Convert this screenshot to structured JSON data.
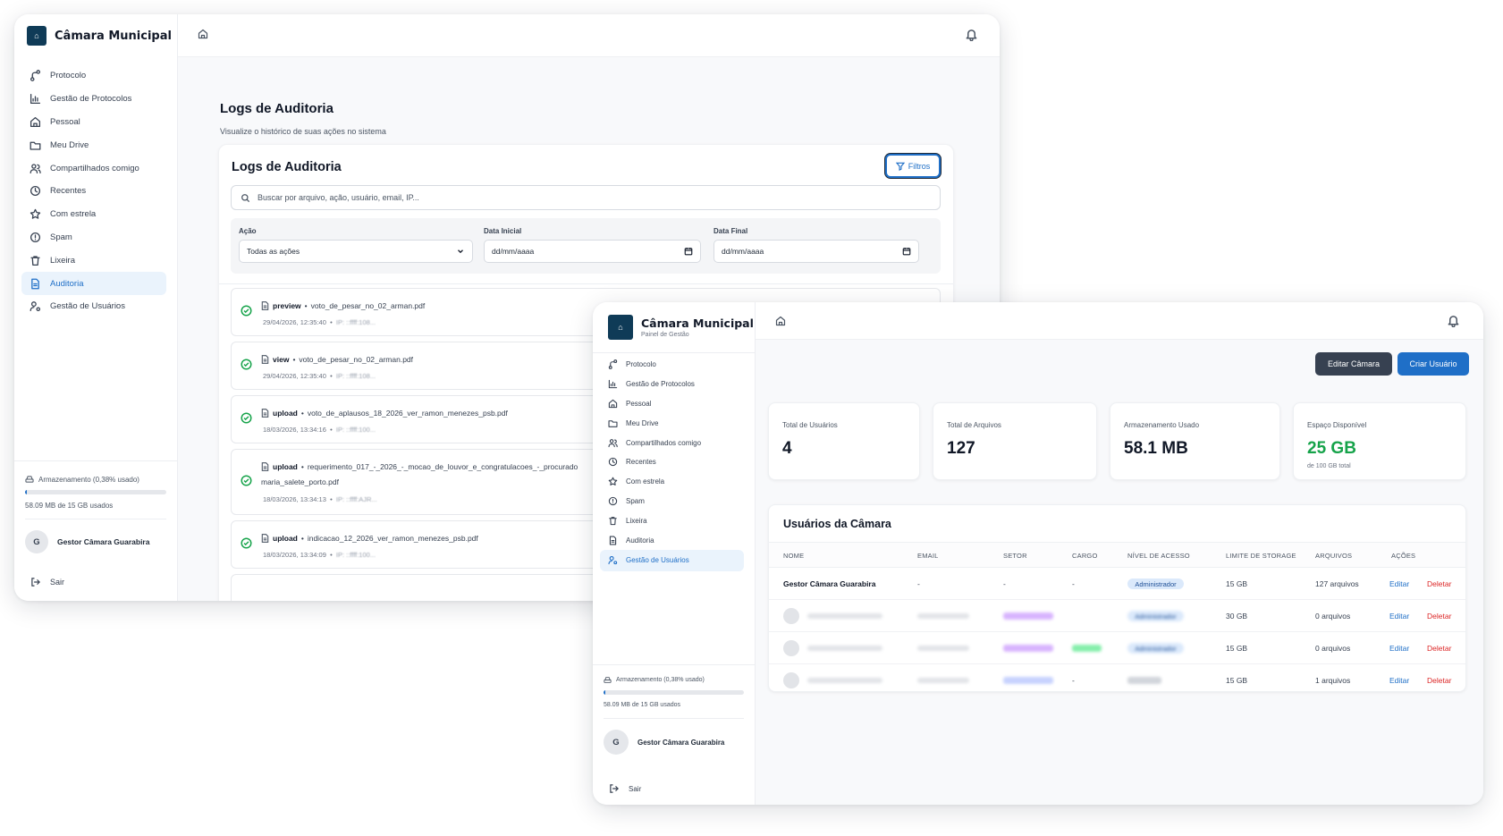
{
  "brand": {
    "title": "Câmara Municipal",
    "subtitle": "Painel de Gestão"
  },
  "nav": {
    "items": [
      {
        "label": "Protocolo",
        "icon": "route-icon"
      },
      {
        "label": "Gestão de Protocolos",
        "icon": "bar-chart-icon"
      },
      {
        "label": "Pessoal",
        "icon": "home-icon"
      },
      {
        "label": "Meu Drive",
        "icon": "folder-icon"
      },
      {
        "label": "Compartilhados comigo",
        "icon": "users-icon"
      },
      {
        "label": "Recentes",
        "icon": "clock-icon"
      },
      {
        "label": "Com estrela",
        "icon": "star-icon"
      },
      {
        "label": "Spam",
        "icon": "alert-circle-icon"
      },
      {
        "label": "Lixeira",
        "icon": "trash-icon"
      },
      {
        "label": "Auditoria",
        "icon": "file-text-icon"
      },
      {
        "label": "Gestão de Usuários",
        "icon": "user-cog-icon"
      }
    ]
  },
  "storage": {
    "label": "Armazenamento (0,38% usado)",
    "used": "58.09 MB de 15 GB usados",
    "percent": 0.38
  },
  "user": {
    "initial": "G",
    "name": "Gestor Câmara Guarabira"
  },
  "logout": "Sair",
  "audit": {
    "page_title": "Logs de Auditoria",
    "page_subtitle": "Visualize o histórico de suas ações no sistema",
    "card_title": "Logs de Auditoria",
    "filters_button": "Filtros",
    "search_placeholder": "Buscar por arquivo, ação, usuário, email, IP...",
    "filters": {
      "action_label": "Ação",
      "action_value": "Todas as ações",
      "start_label": "Data Inicial",
      "start_value": "dd/mm/aaaa",
      "end_label": "Data Final",
      "end_value": "dd/mm/aaaa"
    },
    "logs": [
      {
        "action": "preview",
        "file": "voto_de_pesar_no_02_arman.pdf",
        "file2": "",
        "date": "29/04/2026, 12:35:40",
        "ip": "IP: ::ffff:108..."
      },
      {
        "action": "view",
        "file": "voto_de_pesar_no_02_arman.pdf",
        "file2": "",
        "date": "29/04/2026, 12:35:40",
        "ip": "IP: ::ffff:108..."
      },
      {
        "action": "upload",
        "file": "voto_de_aplausos_18_2026_ver_ramon_menezes_psb.pdf",
        "file2": "",
        "date": "18/03/2026, 13:34:16",
        "ip": "IP: ::ffff:100..."
      },
      {
        "action": "upload",
        "file": "requerimento_017_-_2026_-_mocao_de_louvor_e_congratulacoes_-_procurado",
        "file2": "maria_salete_porto.pdf",
        "date": "18/03/2026, 13:34:13",
        "ip": "IP: ::ffff:AJR..."
      },
      {
        "action": "upload",
        "file": "indicacao_12_2026_ver_ramon_menezes_psb.pdf",
        "file2": "",
        "date": "18/03/2026, 13:34:09",
        "ip": "IP: ::ffff:100..."
      }
    ]
  },
  "management": {
    "edit_button": "Editar Câmara",
    "create_button": "Criar Usuário",
    "stats": [
      {
        "label": "Total de Usuários",
        "value": "4",
        "note": ""
      },
      {
        "label": "Total de Arquivos",
        "value": "127",
        "note": ""
      },
      {
        "label": "Armazenamento Usado",
        "value": "58.1 MB",
        "note": ""
      },
      {
        "label": "Espaço Disponível",
        "value": "25 GB",
        "note": "de 100 GB total"
      }
    ],
    "users_title": "Usuários da Câmara",
    "columns": [
      "NOME",
      "EMAIL",
      "SETOR",
      "CARGO",
      "NÍVEL DE ACESSO",
      "LIMITE DE STORAGE",
      "ARQUIVOS",
      "AÇÕES"
    ],
    "rows": [
      {
        "name": "Gestor Câmara Guarabira",
        "email": "-",
        "setor": "-",
        "cargo": "-",
        "nivel": "Administrador",
        "limite": "15 GB",
        "arquivos": "127 arquivos"
      },
      {
        "name": "",
        "email": "",
        "setor": "",
        "cargo": "",
        "nivel": "Administrador",
        "limite": "30 GB",
        "arquivos": "0 arquivos"
      },
      {
        "name": "",
        "email": "",
        "setor": "",
        "cargo": "",
        "nivel": "Administrador",
        "limite": "15 GB",
        "arquivos": "0 arquivos"
      },
      {
        "name": "",
        "email": "",
        "setor": "",
        "cargo": "-",
        "nivel": "",
        "limite": "15 GB",
        "arquivos": "1 arquivos"
      }
    ],
    "edit_link": "Editar",
    "delete_link": "Deletar"
  },
  "colors": {
    "primary": "#1f6fc7",
    "brand": "#0f3b57",
    "success": "#16a34a",
    "danger": "#dc2626",
    "dark_button": "#374151"
  }
}
